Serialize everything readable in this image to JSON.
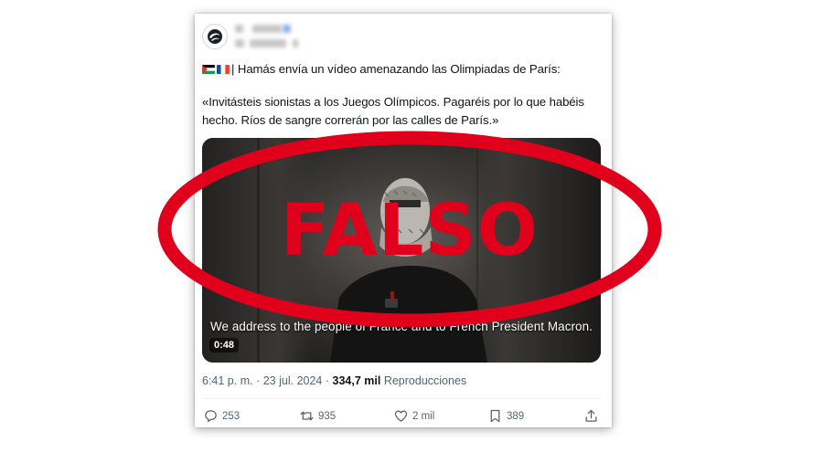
{
  "tweet": {
    "author_name_redacted": "",
    "title_line": "| Hamás envía un vídeo amenazando las Olimpiadas de París:",
    "quote_line1": "«Invitásteis sionistas a los Juegos Olímpicos. Pagaréis por lo que habéis",
    "quote_line2": "hecho. Ríos de sangre correrán por las calles de París.»",
    "flags": [
      "palestine-flag",
      "france-flag"
    ]
  },
  "video": {
    "subtitle": "We address to the people of France and to French President Macron.",
    "duration": "0:48"
  },
  "meta": {
    "time": "6:41 p. m.",
    "separator": "·",
    "date": "23 jul. 2024",
    "views_count": "334,7 mil",
    "views_label": "Reproducciones"
  },
  "actions": {
    "replies": "253",
    "reposts": "935",
    "likes": "2 mil",
    "bookmarks": "389"
  },
  "overlay": {
    "stamp_text": "FALSO",
    "stamp_color": "#e0001b"
  }
}
